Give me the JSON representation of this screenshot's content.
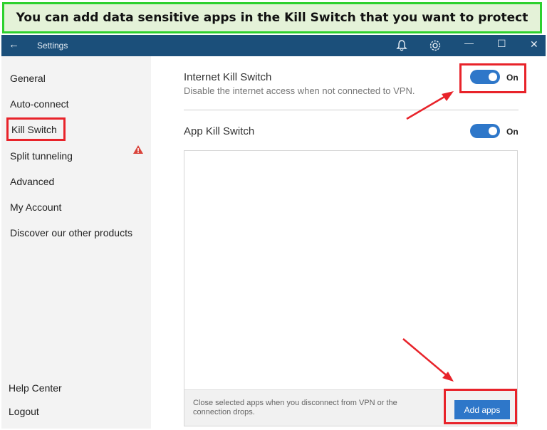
{
  "banner": {
    "text": "You can add data sensitive apps in the Kill Switch that you want to protect"
  },
  "titlebar": {
    "back_icon": "←",
    "title": "Settings",
    "bell_icon": "bell-icon",
    "gear_icon": "gear-icon",
    "minimize": "—",
    "maximize": "☐",
    "close": "✕",
    "color": "#1b4f7a"
  },
  "sidebar": {
    "items": [
      {
        "label": "General"
      },
      {
        "label": "Auto-connect"
      },
      {
        "label": "Kill Switch",
        "selected": true
      },
      {
        "label": "Split tunneling"
      },
      {
        "label": "Advanced"
      },
      {
        "label": "My Account",
        "warning": true
      },
      {
        "label": "Discover our other products"
      }
    ],
    "bottom": [
      {
        "label": "Help Center"
      },
      {
        "label": "Logout"
      }
    ]
  },
  "main": {
    "internet_kill_switch": {
      "title": "Internet Kill Switch",
      "subtitle": "Disable the internet access when not connected to VPN.",
      "state": "On"
    },
    "app_kill_switch": {
      "title": "App Kill Switch",
      "state": "On"
    },
    "footer_text": "Close selected apps when you disconnect from VPN or the connection drops.",
    "add_apps_label": "Add apps"
  },
  "colors": {
    "accent": "#2e77c9",
    "highlight": "#e8232a",
    "banner_border": "#2ed12e",
    "banner_bg": "#e4f2d8"
  }
}
